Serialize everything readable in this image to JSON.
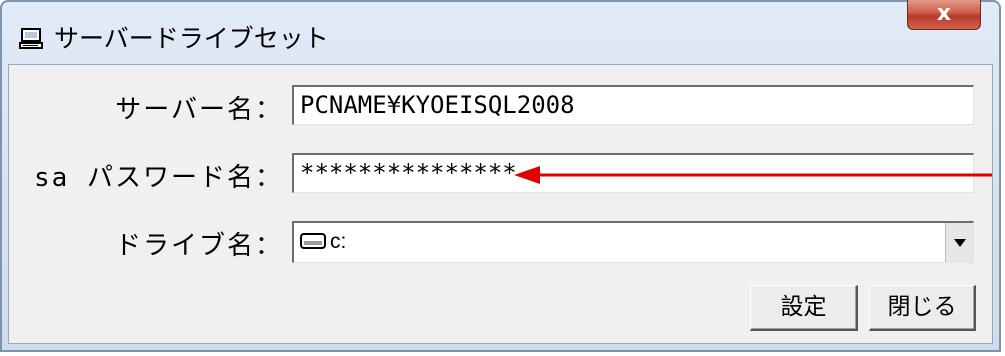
{
  "window": {
    "title": "サーバードライブセット",
    "close_glyph": "x"
  },
  "form": {
    "server_label": "サーバー名：",
    "server_value": "PCNAME¥KYOEISQL2008",
    "password_label": "sa パスワード名：",
    "password_value": "***************",
    "drive_label": "ドライブ名：",
    "drive_value": "c:"
  },
  "buttons": {
    "set_label": "設定",
    "close_label": "閉じる"
  },
  "annotation": {
    "arrow_color": "#e00000"
  },
  "icons": [
    "computer-icon",
    "close-icon",
    "drive-icon",
    "dropdown-arrow-icon"
  ]
}
